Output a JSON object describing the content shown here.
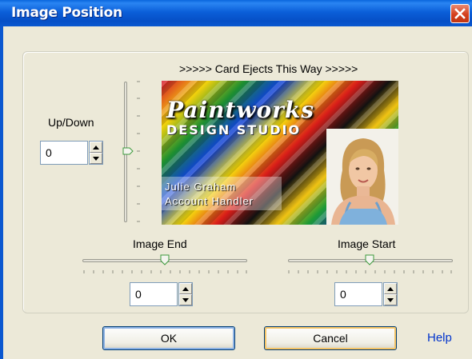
{
  "window": {
    "title": "Image Position",
    "close_icon": "close-icon"
  },
  "preview": {
    "eject_text": ">>>>> Card Ejects This Way >>>>>",
    "card": {
      "brand_line1": "Paintworks",
      "brand_line2": "DESIGN STUDIO",
      "name": "Julie Graham",
      "job_title": "Account Handler"
    }
  },
  "up_down": {
    "label": "Up/Down",
    "value": "0",
    "slider_level": 0.5
  },
  "image_end": {
    "label": "Image End",
    "value": "0",
    "slider_level": 0.5
  },
  "image_start": {
    "label": "Image Start",
    "value": "0",
    "slider_level": 0.5
  },
  "buttons": {
    "ok": "OK",
    "cancel": "Cancel",
    "help": "Help"
  },
  "colors": {
    "titlebar": "#0b5fd9",
    "dialog_bg": "#ece9d8",
    "help_link": "#0033cc",
    "close_button": "#d4401f"
  }
}
